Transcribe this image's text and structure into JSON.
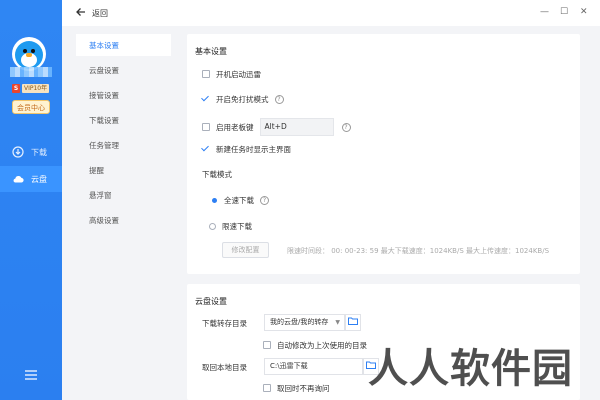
{
  "sidebar": {
    "vip_s": "S",
    "vip_badge": "VIP10年",
    "member_label": "会员中心",
    "nav": [
      {
        "label": "下载",
        "icon": "download-icon",
        "active": false
      },
      {
        "label": "云盘",
        "icon": "cloud-icon",
        "active": true
      }
    ],
    "menu_icon": "menu-icon"
  },
  "topbar": {
    "back_label": "返回",
    "minimize": "—",
    "maximize": "☐",
    "close": "✕"
  },
  "settings_nav": [
    {
      "label": "基本设置",
      "active": true
    },
    {
      "label": "云盘设置"
    },
    {
      "label": "接管设置"
    },
    {
      "label": "下载设置"
    },
    {
      "label": "任务管理"
    },
    {
      "label": "提醒"
    },
    {
      "label": "悬浮窗"
    },
    {
      "label": "高级设置"
    }
  ],
  "basic": {
    "title": "基本设置",
    "auto_start": {
      "label": "开机启动迅雷",
      "checked": false
    },
    "no_disturb": {
      "label": "开启免打扰模式",
      "checked": true
    },
    "boss_key": {
      "label": "启用老板键",
      "checked": false,
      "value": "Alt+D"
    },
    "show_main": {
      "label": "新建任务时显示主界面",
      "checked": true
    },
    "download_mode": {
      "title": "下载模式",
      "full_speed": {
        "label": "全速下载",
        "selected": true
      },
      "limited": {
        "label": "限速下载",
        "selected": false
      },
      "modify_button": "修改配置",
      "limits_text": "限速时间段： 00: 00-23: 59   最大下载速度：1024KB/S   最大上传速度：1024KB/S"
    }
  },
  "cloud": {
    "title": "云盘设置",
    "save_dir_label": "下载转存目录",
    "save_dir_value": "我的云盘/我的转存",
    "auto_modify": {
      "label": "自动修改为上次使用的目录",
      "checked": false
    },
    "local_dir_label": "取回本地目录",
    "local_dir_value": "C:\\迅雷下载",
    "no_ask": {
      "label": "取回时不再询问",
      "checked": false
    }
  },
  "watermark": "人人软件园",
  "colors": {
    "accent": "#2d7ff3",
    "sidebar": "#2f86f3"
  }
}
